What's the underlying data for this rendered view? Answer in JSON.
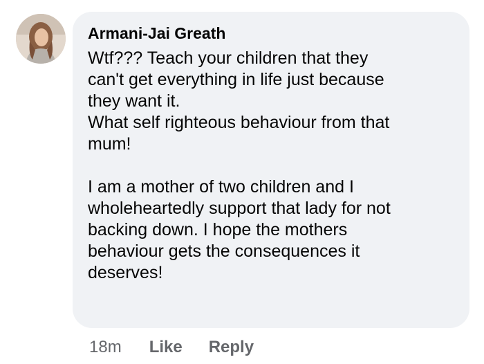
{
  "comment": {
    "author": "Armani-Jai Greath",
    "paragraph_1": "Wtf??? Teach your children that they\ncan't get everything in life just because\nthey want it.\nWhat self righteous behaviour from that\nmum!",
    "paragraph_2": "I am a mother of two children and I\nwholeheartedly support that lady for not\nbacking down. I hope the mothers\nbehaviour gets the consequences it\ndeserves!"
  },
  "actions": {
    "timestamp": "18m",
    "like_label": "Like",
    "reply_label": "Reply"
  },
  "colors": {
    "bubble_background": "#f0f2f5",
    "text": "#050505",
    "secondary_text": "#65676b"
  }
}
